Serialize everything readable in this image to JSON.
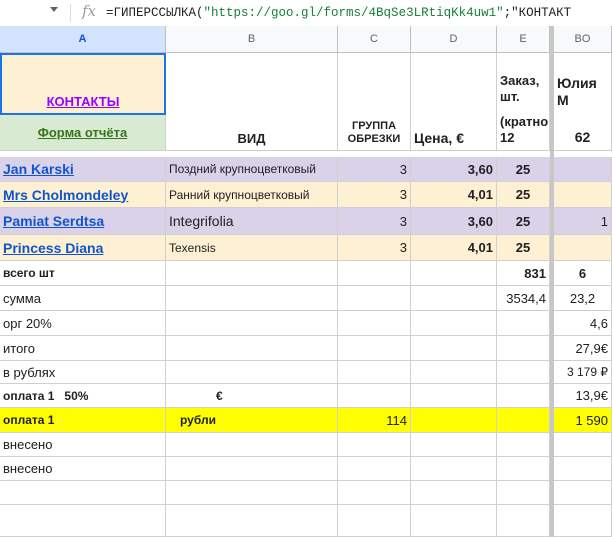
{
  "formula_bar": {
    "fx_label": "fx",
    "prefix": "=ГИПЕРССЫЛКА(",
    "url": "\"https://goo.gl/forms/4BqSe3LRtiqKk4uw1\"",
    "tail": ";\"КОНТАКТ"
  },
  "columns": [
    "A",
    "B",
    "C",
    "D",
    "E",
    "BO"
  ],
  "header": {
    "contacts_link": "КОНТАКТЫ",
    "report_form_link": "Форма отчёта",
    "vid": "ВИД",
    "group": "ГРУППА ОБРЕЗКИ",
    "price": "Цена, €",
    "order_top": "Заказ, шт.",
    "order_bottom": "(кратно 12",
    "customer_name": "Юлия М",
    "customer_num": "62"
  },
  "products": [
    {
      "name": "Jan Karski",
      "vid": "Поздний крупноцветковый",
      "group": "3",
      "price": "3,60",
      "mult": "25",
      "qty": ""
    },
    {
      "name": "Mrs Cholmondeley",
      "vid": "Ранний крупноцветковый",
      "group": "3",
      "price": "4,01",
      "mult": "25",
      "qty": ""
    },
    {
      "name": "Pamiat Serdtsa",
      "vid": "Integrifolia",
      "group": "3",
      "price": "3,60",
      "mult": "25",
      "qty": "1"
    },
    {
      "name": "Princess Diana",
      "vid": "Texensis",
      "group": "3",
      "price": "4,01",
      "mult": "25",
      "qty": ""
    }
  ],
  "summary": {
    "total_label": "всего шт",
    "total_e": "831",
    "total_bo": "6",
    "sum_label": "сумма",
    "sum_e": "3534,4",
    "sum_bo": "23,2",
    "org_label": "орг 20%",
    "org_bo": "4,6",
    "itogo_label": "итого",
    "itogo_bo": "27,9€",
    "rub_label": "в рублях",
    "rub_bo": "3 179 ₽",
    "pay1_label": "оплата 1   50%",
    "pay1_b": "€",
    "pay1_bo": "13,9€",
    "pay1r_label": "оплата 1",
    "pay1r_b": "рубли",
    "pay1r_c": "114",
    "pay1r_bo": "1 590",
    "paid1": "внесено",
    "paid2": "внесено"
  }
}
